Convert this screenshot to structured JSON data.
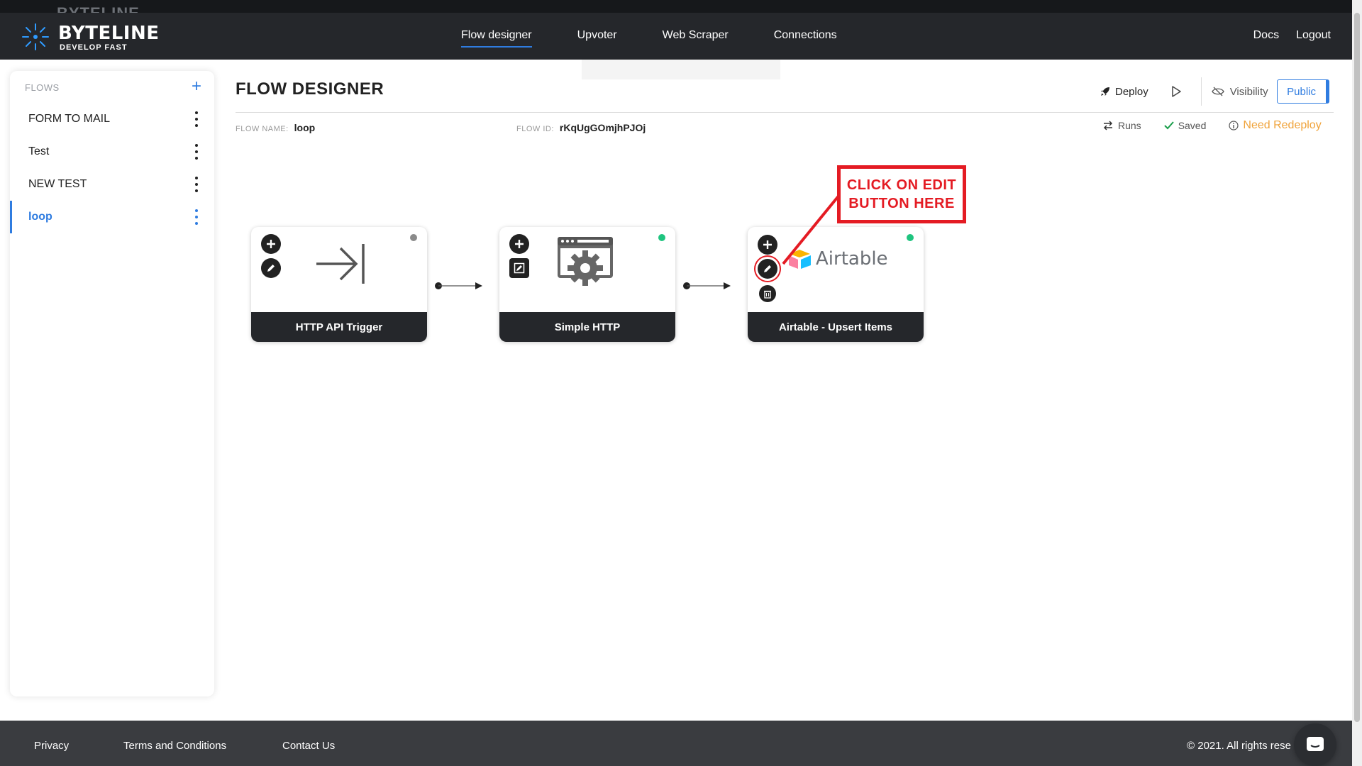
{
  "header": {
    "ghost_title": "BYTELINE",
    "brand_name": "BYTELINE",
    "brand_tagline": "DEVELOP FAST",
    "nav": [
      "Flow designer",
      "Upvoter",
      "Web Scraper",
      "Connections"
    ],
    "active_nav": "Flow designer",
    "docs": "Docs",
    "logout": "Logout"
  },
  "sidebar": {
    "heading": "FLOWS",
    "add_icon": "plus-icon",
    "items": [
      {
        "label": "FORM TO MAIL",
        "active": false
      },
      {
        "label": "Test",
        "active": false
      },
      {
        "label": "NEW TEST",
        "active": false
      },
      {
        "label": "loop",
        "active": true
      }
    ]
  },
  "main": {
    "title": "FLOW DESIGNER",
    "deploy": "Deploy",
    "visibility": "Visibility",
    "public": "Public",
    "flow_name_label": "FLOW NAME:",
    "flow_name": "loop",
    "flow_id_label": "FLOW ID:",
    "flow_id": "rKqUgGOmjhPJOj",
    "runs": "Runs",
    "saved": "Saved",
    "need_redeploy": "Need Redeploy"
  },
  "nodes": [
    {
      "label": "HTTP API Trigger",
      "icon": "arrow-to-line-icon",
      "status": "grey"
    },
    {
      "label": "Simple HTTP",
      "icon": "browser-gear-icon",
      "status": "green"
    },
    {
      "label": "Airtable - Upsert Items",
      "icon": "airtable-logo",
      "logo_text": "Airtable",
      "status": "green"
    }
  ],
  "annotation": {
    "line1": "CLICK ON EDIT",
    "line2": "BUTTON HERE"
  },
  "footer": {
    "privacy": "Privacy",
    "terms": "Terms and Conditions",
    "contact": "Contact Us",
    "copyright": "© 2021. All rights rese"
  },
  "colors": {
    "accent": "#2f7ce0",
    "header_bg": "#25272b",
    "footer_bg": "#3a3c40",
    "status_green": "#1fc47f",
    "status_grey": "#8a8a8a",
    "warning": "#f0a33a",
    "annotation_red": "#e41b23"
  }
}
